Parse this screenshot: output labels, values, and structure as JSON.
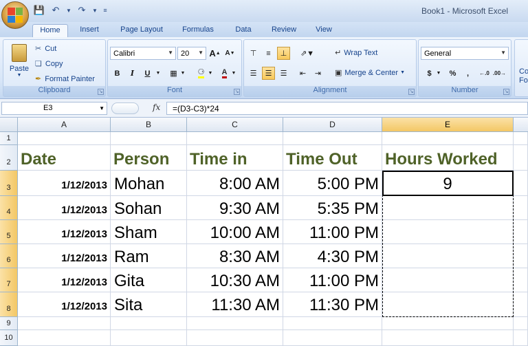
{
  "window": {
    "title": "Book1 - Microsoft Excel"
  },
  "qat": {
    "save_icon": "save-icon",
    "undo_icon": "undo-icon",
    "redo_icon": "redo-icon"
  },
  "tabs": [
    "Home",
    "Insert",
    "Page Layout",
    "Formulas",
    "Data",
    "Review",
    "View"
  ],
  "clipboard": {
    "label": "Clipboard",
    "paste": "Paste",
    "cut": "Cut",
    "copy": "Copy",
    "format_painter": "Format Painter"
  },
  "font": {
    "label": "Font",
    "family": "Calibri",
    "size": "20",
    "grow": "A",
    "shrink": "A",
    "bold": "B",
    "italic": "I",
    "underline": "U",
    "font_color": "A"
  },
  "alignment": {
    "label": "Alignment",
    "wrap_text": "Wrap Text",
    "merge_center": "Merge & Center"
  },
  "number": {
    "label": "Number",
    "format": "General",
    "currency": "$",
    "percent": "%",
    "comma": ","
  },
  "styles": {
    "cond1": "Co",
    "cond2": "Fo"
  },
  "formula_bar": {
    "name_box": "E3",
    "fx": "fx",
    "formula": "=(D3-C3)*24"
  },
  "sheet": {
    "columns": [
      "A",
      "B",
      "C",
      "D",
      "E"
    ],
    "rows": [
      "1",
      "2",
      "3",
      "4",
      "5",
      "6",
      "7",
      "8",
      "9",
      "10"
    ],
    "headers": [
      "Date",
      "Person",
      "Time in",
      "Time Out",
      "Hours Worked"
    ],
    "data": [
      [
        "1/12/2013",
        "Mohan",
        "8:00 AM",
        "5:00 PM",
        "9"
      ],
      [
        "1/12/2013",
        "Sohan",
        "9:30 AM",
        "5:35 PM",
        ""
      ],
      [
        "1/12/2013",
        "Sham",
        "10:00 AM",
        "11:00 PM",
        ""
      ],
      [
        "1/12/2013",
        "Ram",
        "8:30 AM",
        "4:30 PM",
        ""
      ],
      [
        "1/12/2013",
        "Gita",
        "10:30 AM",
        "11:00 PM",
        ""
      ],
      [
        "1/12/2013",
        "Sita",
        "11:30 AM",
        "11:30 PM",
        ""
      ]
    ]
  },
  "colors": {
    "header_text": "#4f6228",
    "selection": "#f3c765"
  }
}
